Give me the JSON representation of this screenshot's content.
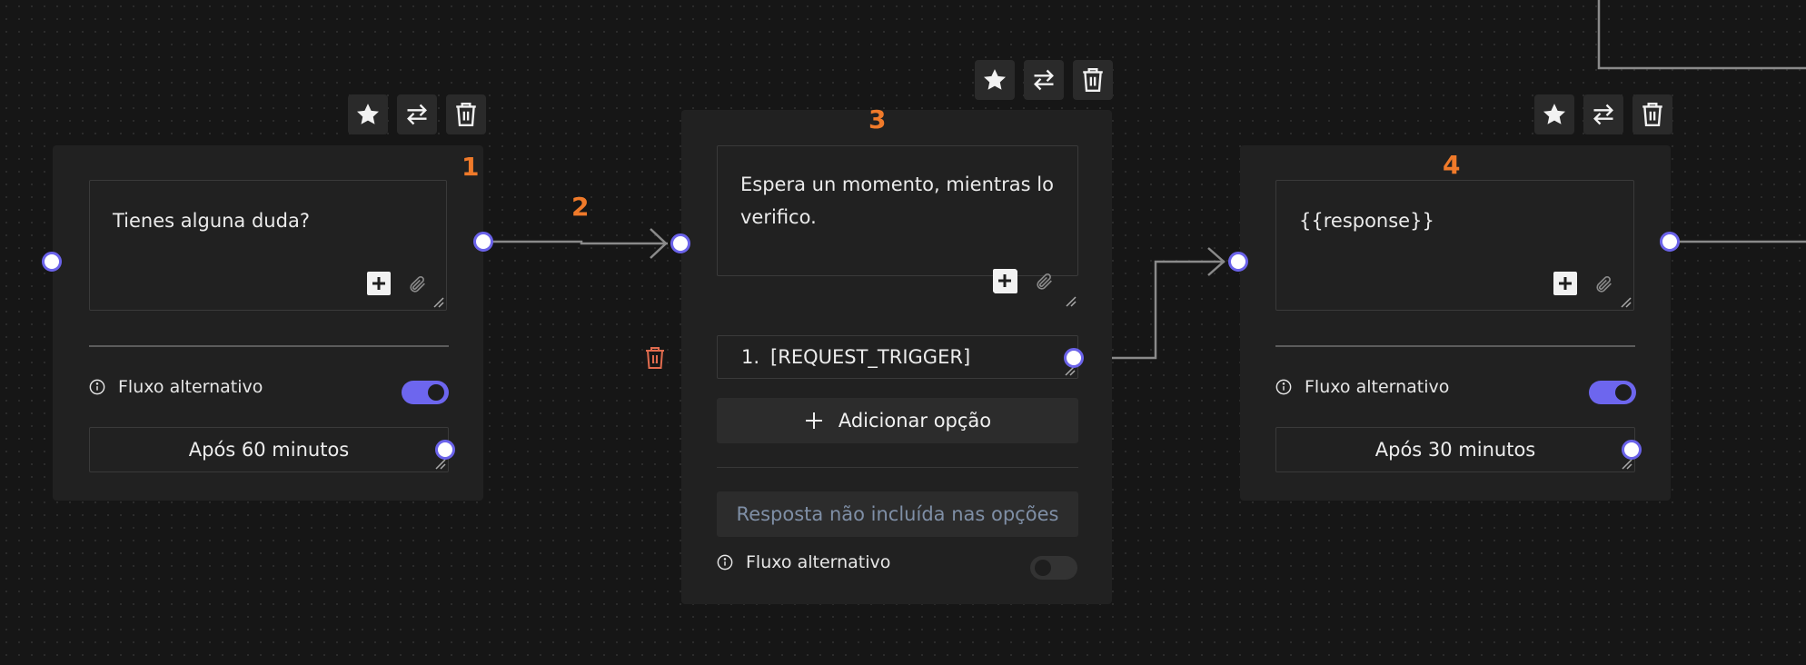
{
  "node_actions": {
    "star_icon": "star-icon",
    "swap_icon": "swap-icon",
    "delete_icon": "trash-icon"
  },
  "nodes": [
    {
      "number": "1",
      "message": "Tienes alguna duda?",
      "alt_flow_label": "Fluxo alternativo",
      "alt_flow_enabled": true,
      "delay_label": "Após 60 minutos"
    },
    {
      "number": "3",
      "message": "Espera un momento, mientras lo verifico.",
      "options": [
        {
          "index": "1.",
          "label": "[REQUEST_TRIGGER]"
        }
      ],
      "add_option_label": "Adicionar opção",
      "fallback_label": "Resposta não incluída nas opções",
      "alt_flow_label": "Fluxo alternativo",
      "alt_flow_enabled": false
    },
    {
      "number": "4",
      "message": "{{response}}",
      "alt_flow_label": "Fluxo alternativo",
      "alt_flow_enabled": true,
      "delay_label": "Após 30 minutos"
    }
  ],
  "connections": [
    {
      "label": "2"
    }
  ],
  "colors": {
    "accent": "#6d66ee",
    "annotation": "#f07a2a",
    "danger": "#e06b4e"
  }
}
